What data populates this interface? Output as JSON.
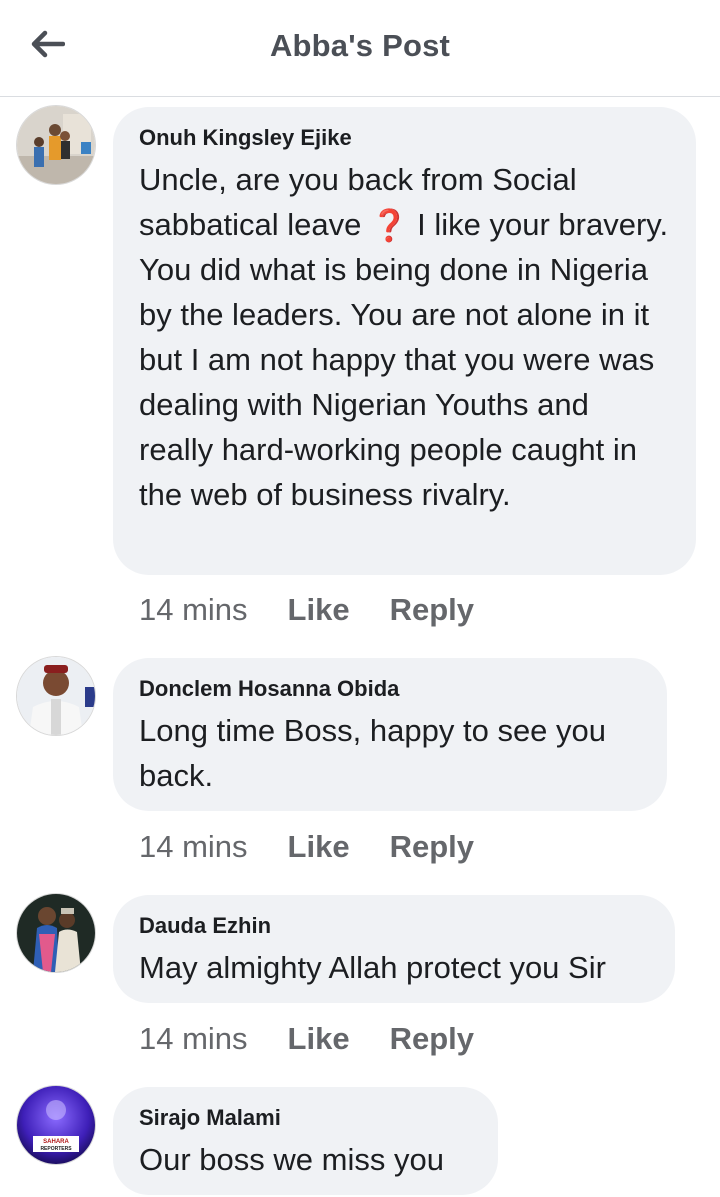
{
  "header": {
    "title": "Abba's Post"
  },
  "comments": [
    {
      "author": "Onuh Kingsley Ejike",
      "text_before": "Uncle, are you back from Social sabbatical leave ",
      "emoji": "❓",
      "text_after": " I like your bravery. You did what is being done in Nigeria by the leaders. You are not alone in it but I am not happy that you were was dealing with Nigerian Youths and really hard-working people caught in the web of business rivalry.",
      "time": "14 mins",
      "like": "Like",
      "reply": "Reply"
    },
    {
      "author": "Donclem Hosanna Obida",
      "text": "Long time Boss, happy to see you back.",
      "time": "14 mins",
      "like": "Like",
      "reply": "Reply"
    },
    {
      "author": "Dauda Ezhin",
      "text": "May almighty Allah protect you Sir",
      "time": "14 mins",
      "like": "Like",
      "reply": "Reply"
    },
    {
      "author": "Sirajo Malami",
      "text": "Our boss we miss you",
      "avatar_caption": "SAHARA REPORTERS"
    }
  ],
  "colors": {
    "bubble": "#f0f2f5",
    "meta": "#65676b",
    "title": "#4b4f56"
  }
}
